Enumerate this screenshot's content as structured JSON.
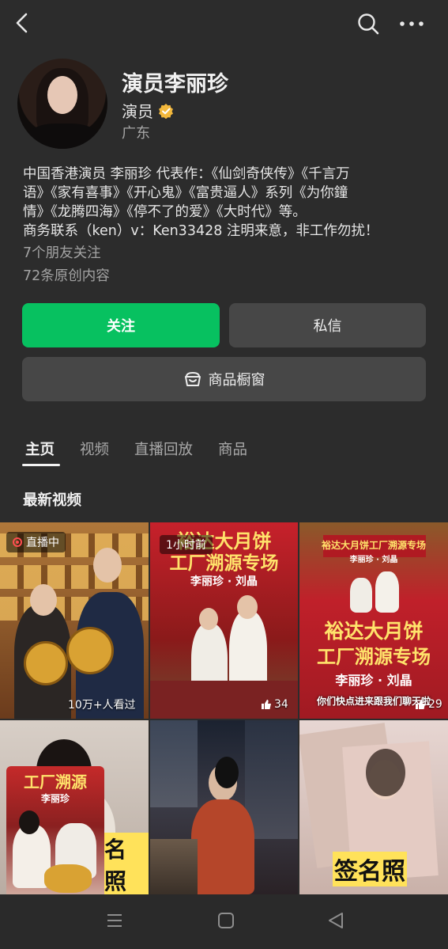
{
  "header": {
    "back_icon": "chevron-left-icon",
    "search_icon": "search-icon",
    "more_icon": "more-dots-icon"
  },
  "profile": {
    "name": "演员李丽珍",
    "role": "演员",
    "region": "广东",
    "verified_color": "#f3b83c"
  },
  "bio": {
    "lines": [
      "中国香港演员 李丽珍  代表作：《仙剑奇侠传》《千言万",
      "语》《家有喜事》《开心鬼》《富贵逼人》系列《为你鐘",
      "情》《龙腾四海》《停不了的爱》《大时代》等。",
      "商务联系（ken）v：Ken33428 注明来意，非工作勿扰！"
    ]
  },
  "stats": {
    "friends_following": "7个朋友关注",
    "original_count": "72条原创内容"
  },
  "buttons": {
    "follow": "关注",
    "message": "私信",
    "shop": "商品橱窗"
  },
  "colors": {
    "follow_bg": "#07c160",
    "secondary_bg": "#474747",
    "page_bg": "#2c2c2c"
  },
  "tabs": [
    "主页",
    "视频",
    "直播回放",
    "商品"
  ],
  "section": {
    "latest_videos": "最新视频"
  },
  "videos": [
    {
      "badge": "直播中",
      "stat": "10万+人看过"
    },
    {
      "badge": "1小时前",
      "banner": "裕达大月饼",
      "banner2": "工厂溯源专场",
      "names": "李丽珍 · 刘晶",
      "likes": "34"
    },
    {
      "banner": "裕达大月饼工厂溯源专场",
      "names": "李丽珍 · 刘晶",
      "big_banner": "裕达大月饼",
      "big_banner2": "工厂溯源专场",
      "big_names": "李丽珍 · 刘晶",
      "caption": "你们快点进来跟我们聊天啦",
      "likes": "29"
    },
    {
      "overlay": "名照"
    },
    {},
    {
      "overlay": "签名照"
    }
  ],
  "pip": {
    "banner": "工厂溯源",
    "names": "李丽珍"
  }
}
